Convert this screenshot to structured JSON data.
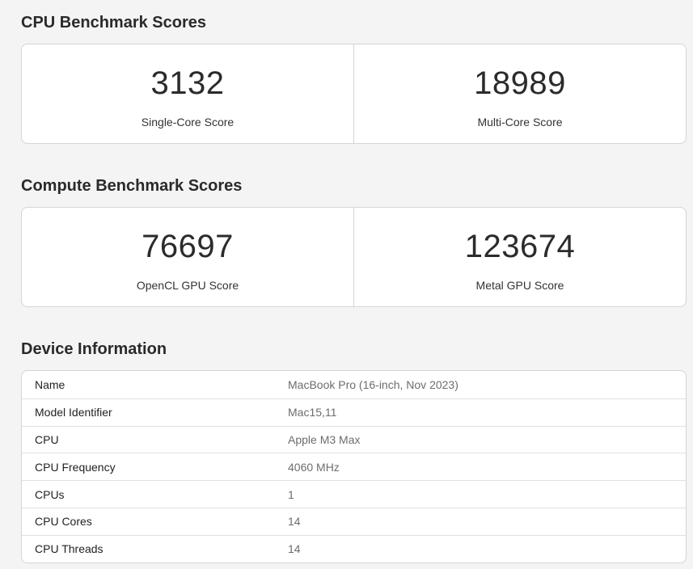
{
  "cpu_section": {
    "title": "CPU Benchmark Scores",
    "scores": [
      {
        "value": "3132",
        "label": "Single-Core Score"
      },
      {
        "value": "18989",
        "label": "Multi-Core Score"
      }
    ]
  },
  "compute_section": {
    "title": "Compute Benchmark Scores",
    "scores": [
      {
        "value": "76697",
        "label": "OpenCL GPU Score"
      },
      {
        "value": "123674",
        "label": "Metal GPU Score"
      }
    ]
  },
  "device_section": {
    "title": "Device Information",
    "rows": [
      {
        "key": "Name",
        "value": "MacBook Pro (16-inch, Nov 2023)"
      },
      {
        "key": "Model Identifier",
        "value": "Mac15,11"
      },
      {
        "key": "CPU",
        "value": "Apple M3 Max"
      },
      {
        "key": "CPU Frequency",
        "value": "4060 MHz"
      },
      {
        "key": "CPUs",
        "value": "1"
      },
      {
        "key": "CPU Cores",
        "value": "14"
      },
      {
        "key": "CPU Threads",
        "value": "14"
      }
    ]
  }
}
